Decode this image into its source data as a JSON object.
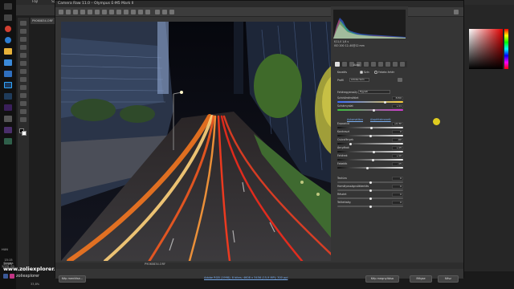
{
  "photoshop": {
    "menu": [
      "Fájl",
      "Szerk"
    ],
    "doc_tab": "P9060834.ORF",
    "zoom": "33,8%",
    "watermark": "www.zoliexplorer.com",
    "social_handle": "zoliexplorer",
    "colors": {
      "fg": "#e10000"
    }
  },
  "taskbar": {
    "lang": "HUN",
    "time": "15:15",
    "day": "Szerda",
    "date": "2020. 02. 12."
  },
  "acr": {
    "title": "Camera Raw 11.0  –  Olympus E-M5 Mark II",
    "zoom": "33,8%",
    "filename": "P9060834.ORF",
    "workflow": "Adobe RGB (1998); 8 bites; 4608 x 3456 (15,9 MP); 300 ppi",
    "camera_info": {
      "line1": "f/11,0    1/4 s",
      "line2": "ISO 200   12–40@12 mm"
    },
    "panel_title": "Alap",
    "treatment_label": "Kezelés",
    "color_option": "Szín",
    "bw_option": "Fekete-fehér",
    "profile_label": "Profil",
    "profile_value": "Adobe Szín",
    "wb_label": "Fehéregyensúly",
    "wb_value": "Egyedi",
    "auto_link": "Automatikus",
    "default_link": "Alapértelmezett",
    "sliders": [
      {
        "name": "temperature",
        "label": "Színhőmérséklet",
        "value": "3150"
      },
      {
        "name": "tint",
        "label": "Színárnyalat",
        "value": "+11"
      },
      {
        "name": "exposure",
        "label": "Expozíció",
        "value": "+0,30"
      },
      {
        "name": "contrast",
        "label": "Kontraszt",
        "value": "0"
      },
      {
        "name": "highlights",
        "label": "Csúcsfények",
        "value": "-60"
      },
      {
        "name": "shadows",
        "label": "Árnyékok",
        "value": "+15"
      },
      {
        "name": "whites",
        "label": "Fehérek",
        "value": "+10"
      },
      {
        "name": "blacks",
        "label": "Feketék",
        "value": "-15"
      },
      {
        "name": "texture",
        "label": "Textúra",
        "value": "0"
      },
      {
        "name": "clarity",
        "label": "Homályosságcsökkentés",
        "value": "0"
      },
      {
        "name": "vibrance",
        "label": "Részlet",
        "value": "0"
      },
      {
        "name": "saturation",
        "label": "Telítettség",
        "value": "0"
      }
    ],
    "buttons": {
      "save": "Kép mentése...",
      "open": "Kép megnyitása",
      "cancel": "Mégse",
      "done": "Kész"
    }
  }
}
